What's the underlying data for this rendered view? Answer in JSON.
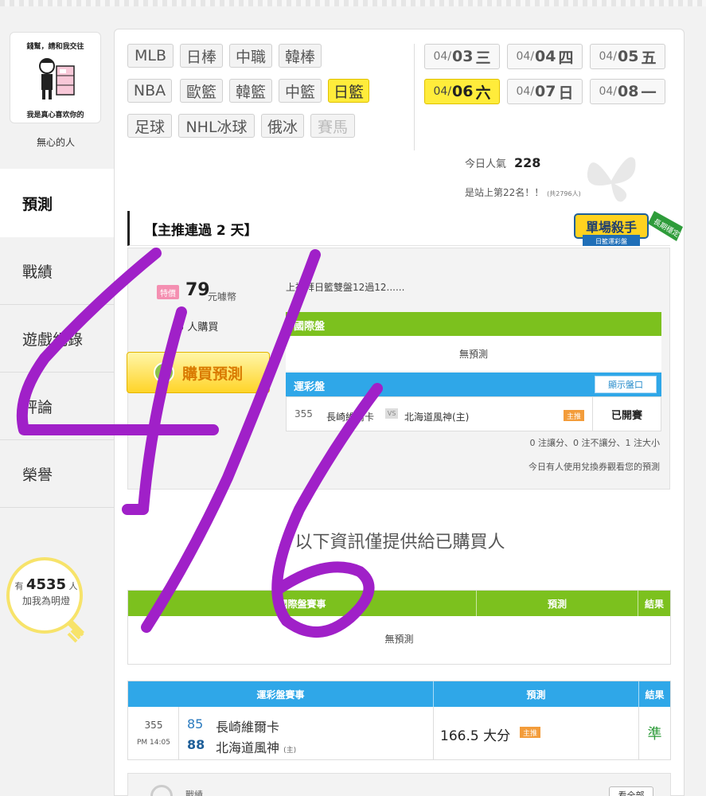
{
  "user": {
    "avatar_caption_top": "錢幫，請和我交往",
    "avatar_caption_bottom": "我是真心喜欢你的",
    "name": "無心的人"
  },
  "nav": {
    "items": [
      {
        "label": "預測",
        "active": true
      },
      {
        "label": "戰績",
        "active": false
      },
      {
        "label": "遊戲紀錄",
        "active": false
      },
      {
        "label": "評論",
        "active": false
      },
      {
        "label": "榮譽",
        "active": false
      }
    ]
  },
  "lamp": {
    "prefix": "有",
    "count": "4535",
    "suffix": "人",
    "cta": "加我為明燈"
  },
  "sports": {
    "row1": [
      "MLB",
      "日棒",
      "中職",
      "韓棒"
    ],
    "row2": [
      "NBA",
      "歐籃",
      "韓籃",
      "中籃",
      "日籃"
    ],
    "row3": [
      "足球",
      "NHL冰球",
      "俄冰",
      "賽馬"
    ],
    "active": "日籃",
    "disabled": "賽馬"
  },
  "dates": [
    {
      "md": "04/",
      "day": "03",
      "wd": "三",
      "active": false
    },
    {
      "md": "04/",
      "day": "04",
      "wd": "四",
      "active": false
    },
    {
      "md": "04/",
      "day": "05",
      "wd": "五",
      "active": false
    },
    {
      "md": "04/",
      "day": "06",
      "wd": "六",
      "active": true
    },
    {
      "md": "04/",
      "day": "07",
      "wd": "日",
      "active": false
    },
    {
      "md": "04/",
      "day": "08",
      "wd": "一",
      "active": false
    }
  ],
  "stats": {
    "popularity_label": "今日人氣",
    "popularity_value": "228",
    "rank_text": "是站上第22名！！",
    "rank_total": "(共2796人)"
  },
  "section": {
    "title": "【主推連過 2 天】"
  },
  "badge": {
    "title": "單場殺手",
    "sub": "日籃運彩盤",
    "ribbon": "長期穩定"
  },
  "offer": {
    "tag": "特價",
    "price": "79",
    "unit": "元噱幣",
    "buyers": "5 人購買",
    "buy_button": "購買預測",
    "coin_icon_text": "噱",
    "description": "上禮拜日籃雙盤12過12......"
  },
  "intl": {
    "header": "國際盤",
    "empty": "無預測"
  },
  "lottery": {
    "header": "運彩盤",
    "show_button": "顯示盤口",
    "game_no": "355",
    "away": "長崎維爾卡",
    "vs": "VS",
    "home": "北海道風神(主)",
    "main_tag": "主推",
    "status": "已開賽",
    "counts": "0 注讓分、0 注不讓分、1 注大小",
    "voucher_note": "今日有人使用兌換券觀看您的預測"
  },
  "notice": "以下資訊僅提供給已購買人",
  "intl_table": {
    "headers": [
      "國際盤賽事",
      "預測",
      "結果"
    ],
    "empty": "無預測"
  },
  "lott_table": {
    "headers": [
      "運彩盤賽事",
      "預測",
      "結果"
    ],
    "row": {
      "no": "355",
      "time": "PM 14:05",
      "away_score": "85",
      "away": "長崎維爾卡",
      "home_score": "88",
      "home": "北海道風神",
      "home_mark": "(主)",
      "prediction": "166.5 大分",
      "tag": "主推",
      "result": "準"
    }
  },
  "record": {
    "label": "戰績",
    "view_all": "看全部"
  },
  "colors": {
    "accent_yellow": "#ffec3b",
    "green_header": "#7cc11e",
    "blue_header": "#2fa7e8",
    "scribble": "#a020c8",
    "win_green": "#2e9c3a"
  }
}
